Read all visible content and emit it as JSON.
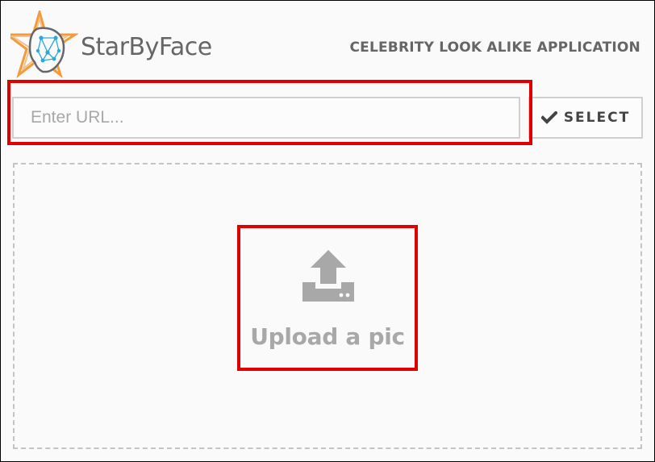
{
  "header": {
    "brand": "StarByFace",
    "tagline": "CELEBRITY LOOK ALIKE APPLICATION",
    "logo_icon": "star-face-logo-icon"
  },
  "url_form": {
    "placeholder": "Enter URL...",
    "value": "",
    "select_label": "SELECT",
    "select_icon": "check-icon"
  },
  "upload": {
    "label": "Upload a pic",
    "icon": "upload-icon"
  },
  "colors": {
    "text_gray": "#666666",
    "upload_gray": "#a8a8a8",
    "border_gray": "#d0d0d0",
    "highlight_red": "#e00000",
    "logo_star_outer": "#f39a3b",
    "logo_star_inner": "#f6c28a",
    "logo_face_blue": "#2aa7e1"
  }
}
